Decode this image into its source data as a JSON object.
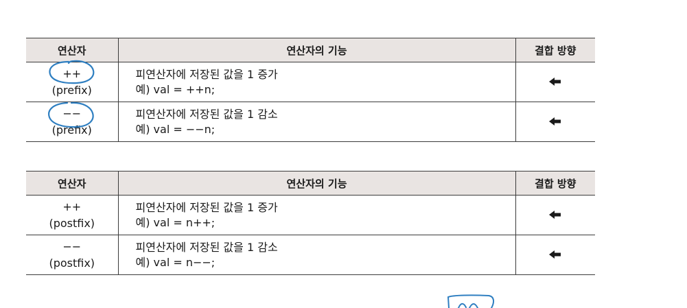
{
  "headers": {
    "operator": "연산자",
    "function": "연산자의 기능",
    "direction": "결합 방향"
  },
  "prefix_rows": [
    {
      "symbol": "++",
      "kind": "(prefix)",
      "desc": "피연산자에 저장된 값을 1 증가",
      "example": "예) val = ++n;",
      "direction_icon": "left-arrow-icon"
    },
    {
      "symbol": "−−",
      "kind": "(prefix)",
      "desc": "피연산자에 저장된 값을 1 감소",
      "example": "예) val = −−n;",
      "direction_icon": "left-arrow-icon"
    }
  ],
  "postfix_rows": [
    {
      "symbol": "++",
      "kind": "(postfix)",
      "desc": "피연산자에 저장된 값을 1 증가",
      "example": "예) val = n++;",
      "direction_icon": "left-arrow-icon"
    },
    {
      "symbol": "−−",
      "kind": "(postfix)",
      "desc": "피연산자에 저장된 값을 1 감소",
      "example": "예) val = n−−;",
      "direction_icon": "left-arrow-icon"
    }
  ],
  "colors": {
    "header_bg": "#e9e4e2",
    "rule": "#3a3a3a",
    "annotation_ink": "#2f7fc1"
  }
}
